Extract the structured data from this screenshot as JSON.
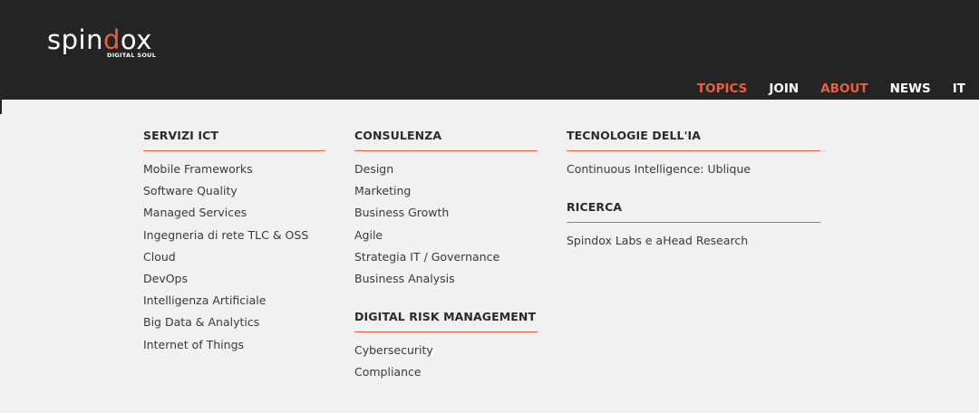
{
  "logo": {
    "word_pre": "spin",
    "word_d": "d",
    "word_post": "ox",
    "tagline": "DIGITAL SOUL"
  },
  "nav": [
    {
      "label": "TOPICS",
      "accent": true
    },
    {
      "label": "JOIN",
      "accent": false
    },
    {
      "label": "ABOUT",
      "accent": true
    },
    {
      "label": "NEWS",
      "accent": false
    },
    {
      "label": "IT",
      "accent": false
    }
  ],
  "colors": {
    "header_bg": "#242424",
    "accent": "#e8613a",
    "menu_bg": "#f1f1f1"
  },
  "menu": {
    "servizi": {
      "title": "SERVIZI ICT",
      "items": [
        "Mobile Frameworks",
        "Software Quality",
        "Managed Services",
        "Ingegneria di rete TLC & OSS",
        "Cloud",
        "DevOps",
        "Intelligenza Artificiale",
        "Big Data & Analytics",
        "Internet of Things"
      ]
    },
    "consulenza": {
      "title": "CONSULENZA",
      "items": [
        "Design",
        "Marketing",
        "Business Growth",
        "Agile",
        "Strategia IT / Governance",
        "Business Analysis"
      ]
    },
    "risk": {
      "title": "DIGITAL RISK MANAGEMENT",
      "items": [
        "Cybersecurity",
        "Compliance"
      ]
    },
    "tecnologie": {
      "title": "TECNOLOGIE DELL'IA",
      "items": [
        "Continuous Intelligence: Ublique"
      ]
    },
    "ricerca": {
      "title": "RICERCA",
      "items": [
        "Spindox Labs e aHead Research"
      ]
    }
  }
}
